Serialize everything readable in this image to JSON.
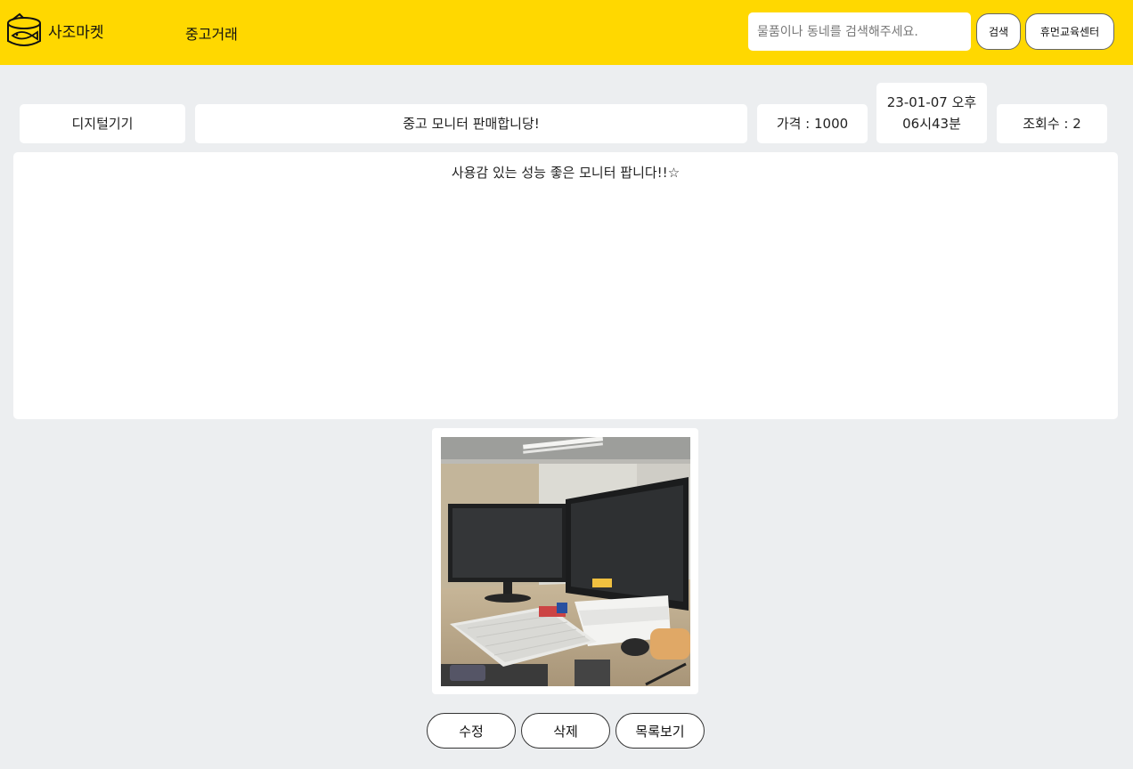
{
  "header": {
    "brand": "사조마켓",
    "logo_icon": "tuna-can-icon",
    "nav_label": "중고거래",
    "search_placeholder": "물품이나 동네를 검색해주세요.",
    "search_button": "검색",
    "center_button": "휴먼교육센터",
    "bg_color": "#ffd800"
  },
  "post": {
    "category": "디지털기기",
    "title": "중고 모니터 판매합니당!",
    "price": "가격 : 1000",
    "date_line1": "23-01-07 오후",
    "date_line2": "06시43분",
    "views": "조회수 : 2",
    "content": "사용감 있는 성능 좋은 모니터 팝니다!!☆"
  },
  "photo": {
    "subject": "monitor-photo"
  },
  "actions": {
    "edit": "수정",
    "delete": "삭제",
    "list": "목록보기"
  }
}
